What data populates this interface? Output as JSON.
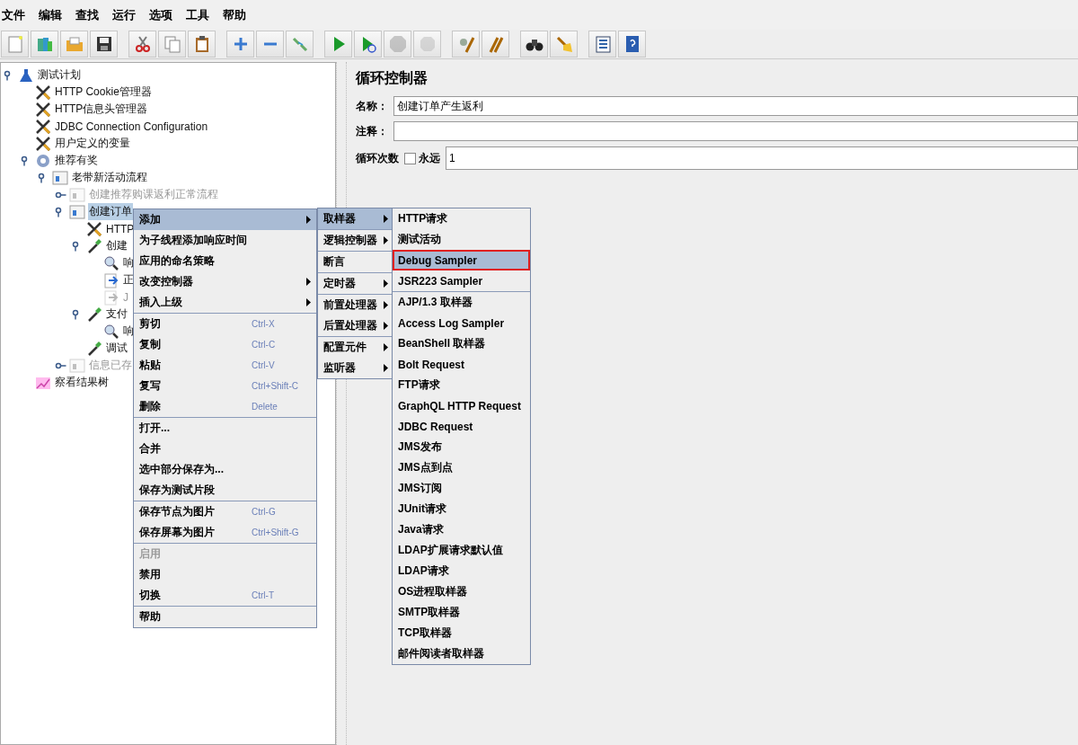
{
  "menubar": [
    "文件",
    "编辑",
    "查找",
    "运行",
    "选项",
    "工具",
    "帮助"
  ],
  "toolbar": [
    {
      "kind": "new",
      "disabled": false
    },
    {
      "kind": "templates",
      "disabled": false
    },
    {
      "kind": "open",
      "disabled": false
    },
    {
      "kind": "save",
      "disabled": false
    },
    {
      "kind": "cut",
      "disabled": false
    },
    {
      "kind": "copy",
      "disabled": false
    },
    {
      "kind": "paste",
      "disabled": false
    },
    {
      "kind": "expand",
      "disabled": false
    },
    {
      "kind": "collapse",
      "disabled": false
    },
    {
      "kind": "toggle",
      "disabled": false
    },
    {
      "kind": "start",
      "disabled": false
    },
    {
      "kind": "start-no-pause",
      "disabled": false
    },
    {
      "kind": "stop",
      "disabled": true
    },
    {
      "kind": "shutdown",
      "disabled": true
    },
    {
      "kind": "clear",
      "disabled": false
    },
    {
      "kind": "clear-all",
      "disabled": false
    },
    {
      "kind": "search",
      "disabled": false
    },
    {
      "kind": "reset-search",
      "disabled": false
    },
    {
      "kind": "functions",
      "disabled": false
    },
    {
      "kind": "help",
      "disabled": false
    }
  ],
  "tree": [
    {
      "label": "测试计划",
      "kind": "plan",
      "expanded": true,
      "selected": false,
      "disabled": false,
      "children": [
        {
          "label": "HTTP Cookie管理器",
          "kind": "config",
          "selected": false,
          "disabled": false
        },
        {
          "label": "HTTP信息头管理器",
          "kind": "config",
          "selected": false,
          "disabled": false
        },
        {
          "label": "JDBC Connection Configuration",
          "kind": "config",
          "selected": false,
          "disabled": false
        },
        {
          "label": "用户定义的变量",
          "kind": "config",
          "selected": false,
          "disabled": false
        },
        {
          "label": "推荐有奖",
          "kind": "threads",
          "expanded": true,
          "selected": false,
          "disabled": false,
          "children": [
            {
              "label": "老带新活动流程",
              "kind": "controller",
              "expanded": true,
              "selected": false,
              "disabled": false,
              "children": [
                {
                  "label": "创建推荐购课返利正常流程",
                  "kind": "controller",
                  "expanded": false,
                  "selected": false,
                  "disabled": true
                },
                {
                  "label": "创建订单",
                  "kind": "controller",
                  "expanded": true,
                  "selected": true,
                  "disabled": false,
                  "children": [
                    {
                      "label": "HTTP",
                      "kind": "config",
                      "selected": false,
                      "disabled": false
                    },
                    {
                      "label": "创建",
                      "kind": "sampler",
                      "expanded": true,
                      "selected": false,
                      "disabled": false,
                      "children": [
                        {
                          "label": "响",
                          "kind": "assertion",
                          "selected": false,
                          "disabled": false
                        },
                        {
                          "label": "正",
                          "kind": "extractor",
                          "selected": false,
                          "disabled": false
                        },
                        {
                          "label": "J",
                          "kind": "extractor",
                          "selected": false,
                          "disabled": true
                        }
                      ]
                    },
                    {
                      "label": "支付",
                      "kind": "sampler",
                      "expanded": true,
                      "selected": false,
                      "disabled": false,
                      "children": [
                        {
                          "label": "响",
                          "kind": "assertion",
                          "selected": false,
                          "disabled": false
                        }
                      ]
                    },
                    {
                      "label": "调试",
                      "kind": "sampler",
                      "selected": false,
                      "disabled": false
                    }
                  ]
                },
                {
                  "label": "信息已存",
                  "kind": "controller",
                  "expanded": false,
                  "selected": false,
                  "disabled": true
                }
              ]
            }
          ]
        },
        {
          "label": "察看结果树",
          "kind": "listener",
          "selected": false,
          "disabled": false
        }
      ]
    }
  ],
  "panel": {
    "title": "循环控制器",
    "name_label": "名称：",
    "name_value": "创建订单产生返利",
    "comment_label": "注释：",
    "loops_label": "循环次数",
    "forever": {
      "label": "永远",
      "checked": false
    },
    "loops_value": "1"
  },
  "context_menu": {
    "groups": [
      [
        {
          "label": "添加",
          "submenu": true,
          "selected": true,
          "disabled": false
        },
        {
          "label": "为子线程添加响应时间",
          "submenu": false,
          "selected": false,
          "disabled": false
        },
        {
          "label": "应用的命名策略",
          "submenu": false,
          "selected": false,
          "disabled": false
        },
        {
          "label": "改变控制器",
          "submenu": true,
          "selected": false,
          "disabled": false
        },
        {
          "label": "插入上级",
          "submenu": true,
          "selected": false,
          "disabled": false
        }
      ],
      [
        {
          "label": "剪切",
          "shortcut": "Ctrl-X",
          "submenu": false,
          "selected": false,
          "disabled": false
        },
        {
          "label": "复制",
          "shortcut": "Ctrl-C",
          "submenu": false,
          "selected": false,
          "disabled": false
        },
        {
          "label": "粘贴",
          "shortcut": "Ctrl-V",
          "submenu": false,
          "selected": false,
          "disabled": false
        },
        {
          "label": "复写",
          "shortcut": "Ctrl+Shift-C",
          "submenu": false,
          "selected": false,
          "disabled": false
        },
        {
          "label": "删除",
          "shortcut": "Delete",
          "submenu": false,
          "selected": false,
          "disabled": false
        }
      ],
      [
        {
          "label": "打开...",
          "submenu": false,
          "selected": false,
          "disabled": false
        },
        {
          "label": "合并",
          "submenu": false,
          "selected": false,
          "disabled": false
        },
        {
          "label": "选中部分保存为...",
          "submenu": false,
          "selected": false,
          "disabled": false
        },
        {
          "label": "保存为测试片段",
          "submenu": false,
          "selected": false,
          "disabled": false
        }
      ],
      [
        {
          "label": "保存节点为图片",
          "shortcut": "Ctrl-G",
          "submenu": false,
          "selected": false,
          "disabled": false
        },
        {
          "label": "保存屏幕为图片",
          "shortcut": "Ctrl+Shift-G",
          "submenu": false,
          "selected": false,
          "disabled": false
        }
      ],
      [
        {
          "label": "启用",
          "submenu": false,
          "selected": false,
          "disabled": true
        },
        {
          "label": "禁用",
          "submenu": false,
          "selected": false,
          "disabled": false
        },
        {
          "label": "切换",
          "shortcut": "Ctrl-T",
          "submenu": false,
          "selected": false,
          "disabled": false
        }
      ],
      [
        {
          "label": "帮助",
          "submenu": false,
          "selected": false,
          "disabled": false
        }
      ]
    ]
  },
  "add_submenu": {
    "groups": [
      [
        {
          "label": "取样器",
          "submenu": true,
          "selected": true
        }
      ],
      [
        {
          "label": "逻辑控制器",
          "submenu": true,
          "selected": false
        }
      ],
      [
        {
          "label": "断言",
          "submenu": false,
          "selected": false
        }
      ],
      [
        {
          "label": "定时器",
          "submenu": true,
          "selected": false
        }
      ],
      [
        {
          "label": "前置处理器",
          "submenu": true,
          "selected": false
        },
        {
          "label": "后置处理器",
          "submenu": true,
          "selected": false
        }
      ],
      [
        {
          "label": "配置元件",
          "submenu": true,
          "selected": false
        },
        {
          "label": "监听器",
          "submenu": true,
          "selected": false
        }
      ]
    ]
  },
  "sampler_submenu": {
    "groups": [
      [
        {
          "label": "HTTP请求",
          "selected": false,
          "highlighted": false
        },
        {
          "label": "测试活动",
          "selected": false,
          "highlighted": false
        },
        {
          "label": "Debug Sampler",
          "selected": true,
          "highlighted": true
        },
        {
          "label": "JSR223 Sampler",
          "selected": false,
          "highlighted": false
        }
      ],
      [
        {
          "label": "AJP/1.3 取样器",
          "selected": false,
          "highlighted": false
        },
        {
          "label": "Access Log Sampler",
          "selected": false,
          "highlighted": false
        },
        {
          "label": "BeanShell 取样器",
          "selected": false,
          "highlighted": false
        },
        {
          "label": "Bolt Request",
          "selected": false,
          "highlighted": false
        },
        {
          "label": "FTP请求",
          "selected": false,
          "highlighted": false
        },
        {
          "label": "GraphQL HTTP Request",
          "selected": false,
          "highlighted": false
        },
        {
          "label": "JDBC Request",
          "selected": false,
          "highlighted": false
        },
        {
          "label": "JMS发布",
          "selected": false,
          "highlighted": false
        },
        {
          "label": "JMS点到点",
          "selected": false,
          "highlighted": false
        },
        {
          "label": "JMS订阅",
          "selected": false,
          "highlighted": false
        },
        {
          "label": "JUnit请求",
          "selected": false,
          "highlighted": false
        },
        {
          "label": "Java请求",
          "selected": false,
          "highlighted": false
        },
        {
          "label": "LDAP扩展请求默认值",
          "selected": false,
          "highlighted": false
        },
        {
          "label": "LDAP请求",
          "selected": false,
          "highlighted": false
        },
        {
          "label": "OS进程取样器",
          "selected": false,
          "highlighted": false
        },
        {
          "label": "SMTP取样器",
          "selected": false,
          "highlighted": false
        },
        {
          "label": "TCP取样器",
          "selected": false,
          "highlighted": false
        },
        {
          "label": "邮件阅读者取样器",
          "selected": false,
          "highlighted": false
        }
      ]
    ]
  }
}
